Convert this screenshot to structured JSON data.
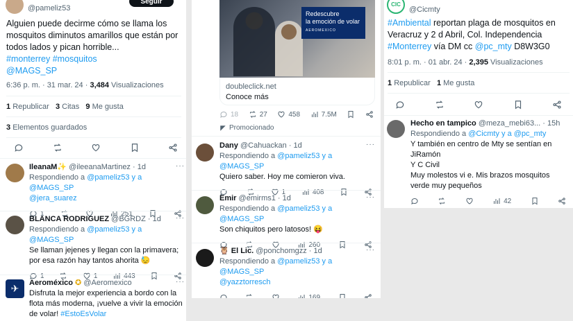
{
  "col1": {
    "author_handle": "@pameliz53",
    "follow_label": "Seguir",
    "tweet_text": "Alguien puede decirme cómo se llama los mosquitos diminutos amarillos que están por todos lados y pican horrible...",
    "hashtags": [
      "#monterrey",
      "#mosquitos"
    ],
    "mention": "@MAGS_SP",
    "timestamp": "6:36 p. m. · 31 mar. 24 · ",
    "views_count": "3,484",
    "views_label": " Visualizaciones",
    "stats": [
      {
        "num": "1",
        "label": "Republicar"
      },
      {
        "num": "3",
        "label": "Citas"
      },
      {
        "num": "9",
        "label": "Me gusta"
      }
    ],
    "saved": {
      "num": "3",
      "label": "Elementos guardados"
    },
    "replies": [
      {
        "name": "IleanaM✨",
        "handle": "@ileeanaMartinez · 1d",
        "replying_prefix": "Respondiendo a ",
        "replying_to": "@pameliz53 y a @MAGS_SP",
        "text": "",
        "text_link": "@jera_suarez",
        "reply_count": "1",
        "retweet_count": "",
        "like_count": "",
        "views": "251",
        "avatar_color": "#a07a4a"
      },
      {
        "name": "BLANCA RODRIGUEZ",
        "handle": "@BGRDZ · 1d",
        "replying_prefix": "Respondiendo a ",
        "replying_to": "@pameliz53 y a @MAGS_SP",
        "text": "Se llaman jejenes y llegan con la primavera; por esa razón hay tantos ahorita 😓",
        "text_link": "",
        "reply_count": "1",
        "retweet_count": "",
        "like_count": "1",
        "views": "443",
        "avatar_color": "#5a5246"
      }
    ],
    "ad": {
      "name": "Aeroméxico",
      "verified": "✪",
      "handle": "@Aeromexico",
      "text": "Disfruta la mejor experiencia a bordo con la flota más moderna, ¡vuelve a vivir la emoción de volar! ",
      "hashtag": "#EstoEsVolar",
      "avatar_color": "#0b2d6b"
    }
  },
  "col2": {
    "ad_card": {
      "overlay_line1": "Redescubre",
      "overlay_line2": "la emoción de volar",
      "overlay_brand": "AEROMEXICO",
      "domain": "doubleclick.net",
      "cta": "Conoce más"
    },
    "ad_stats": {
      "reply": "18",
      "retweet": "27",
      "like": "458",
      "views": "7.5M"
    },
    "promoted_label": "Promocionado",
    "replies": [
      {
        "name": "Dany",
        "handle": "@Cahuackan · 1d",
        "replying_prefix": "Respondiendo a ",
        "replying_to": "@pameliz53 y a @MAGS_SP",
        "text": "Quiero saber. Hoy me comieron viva.",
        "text_link": "",
        "reply_count": "",
        "like_count": "1",
        "views": "408",
        "avatar_color": "#6b4f3a"
      },
      {
        "name": "Emir",
        "handle": "@emirms1 · 1d",
        "replying_prefix": "Respondiendo a ",
        "replying_to": "@pameliz53 y a @MAGS_SP",
        "text": "Son chiquitos pero latosos! 😝",
        "text_link": "",
        "reply_count": "",
        "like_count": "",
        "views": "260",
        "avatar_color": "#4f5a3e"
      },
      {
        "name": "🦉 El Lic.",
        "handle": "@ponchomgzz · 1d",
        "replying_prefix": "Respondiendo a ",
        "replying_to": "@pameliz53 y a @MAGS_SP",
        "text": "",
        "text_link": "@yazztorresch",
        "reply_count": "",
        "like_count": "",
        "views": "169",
        "avatar_color": "#1a1a1a"
      }
    ]
  },
  "col3": {
    "author_handle": "@Cicmty",
    "avatar_text": "CIC",
    "tweet_link1": "#Ambiental",
    "tweet_text1": " reportan plaga de mosquitos en Veracruz y 2 d Abril, Col. Independencia ",
    "tweet_link2": "#Monterrey",
    "tweet_text2": " vía DM cc ",
    "tweet_link3": "@pc_mty",
    "tweet_text3": " D8W3G0",
    "timestamp": "8:01 p. m. · 01 abr. 24 · ",
    "views_count": "2,395",
    "views_label": " Visualizaciones",
    "stats": [
      {
        "num": "1",
        "label": "Republicar"
      },
      {
        "num": "1",
        "label": "Me gusta"
      }
    ],
    "reply": {
      "name": "Hecho en tampico",
      "handle": "@meza_mebi63... · 15h",
      "replying_prefix": "Respondiendo a ",
      "replying_to": "@Cicmty y a @pc_mty",
      "text_lines": [
        "Y también en centro de Mty se sentían en",
        "JiRamón",
        "Y C Civil",
        "Muy molestos vi e. Mis brazos mosquitos",
        "verde muy pequeños"
      ],
      "views": "42",
      "avatar_color": "#6a6a6a"
    }
  },
  "colors": {
    "link": "#1d9bf0",
    "muted": "#536471",
    "text": "#0f1419"
  },
  "icons": [
    "reply-icon",
    "retweet-icon",
    "like-icon",
    "views-icon",
    "bookmark-icon",
    "share-icon",
    "more-icon",
    "verified-icon",
    "promoted-icon"
  ]
}
